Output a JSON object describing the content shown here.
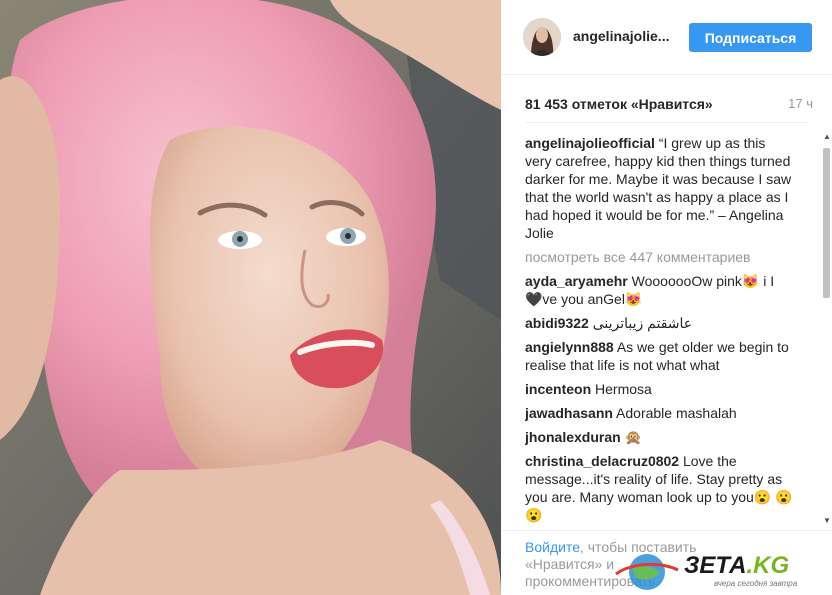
{
  "post": {
    "username": "angelinajolie...",
    "follow_label": "Подписаться",
    "likes": "81 453 отметок «Нравится»",
    "time": "17 ч"
  },
  "comments": [
    {
      "user": "angelinajolieofficial",
      "text": " “I grew up as this very carefree, happy kid then things turned darker for me. Maybe it was because I saw that the world wasn't as happy a place as I had hoped it would be for me.” – Angelina Jolie"
    },
    {
      "user": "ayda_aryamehr",
      "text": " WooooooOw pink😻 i I 🖤ve you anGel😻"
    },
    {
      "user": "abidi9322",
      "text": " عاشقتم زيباترينى"
    },
    {
      "user": "angielynn888",
      "text": " As we get older we begin to realise that life is not what what"
    },
    {
      "user": "incenteon",
      "text": " Hermosa"
    },
    {
      "user": "jawadhasann",
      "text": " Adorable mashalah"
    },
    {
      "user": "jhonalexduran",
      "text": " 🙊"
    },
    {
      "user": "christina_delacruz0802",
      "text": " Love the message...it's reality of life. Stay pretty as you are. Many woman look up to you😮 😮😮"
    }
  ],
  "view_all": "посмотреть все 447 комментариев",
  "login": {
    "link": "Войдите",
    "text": ", чтобы поставить «Нравится» и прокомментировать."
  },
  "watermark": {
    "brand_main": "ЗЕТА",
    "brand_tld": ".KG",
    "tagline": "вчера сегодня завтра"
  },
  "colors": {
    "accent": "#3897f0",
    "muted": "#999999",
    "hair": "#f2a3b8",
    "lips": "#d84e5c"
  }
}
